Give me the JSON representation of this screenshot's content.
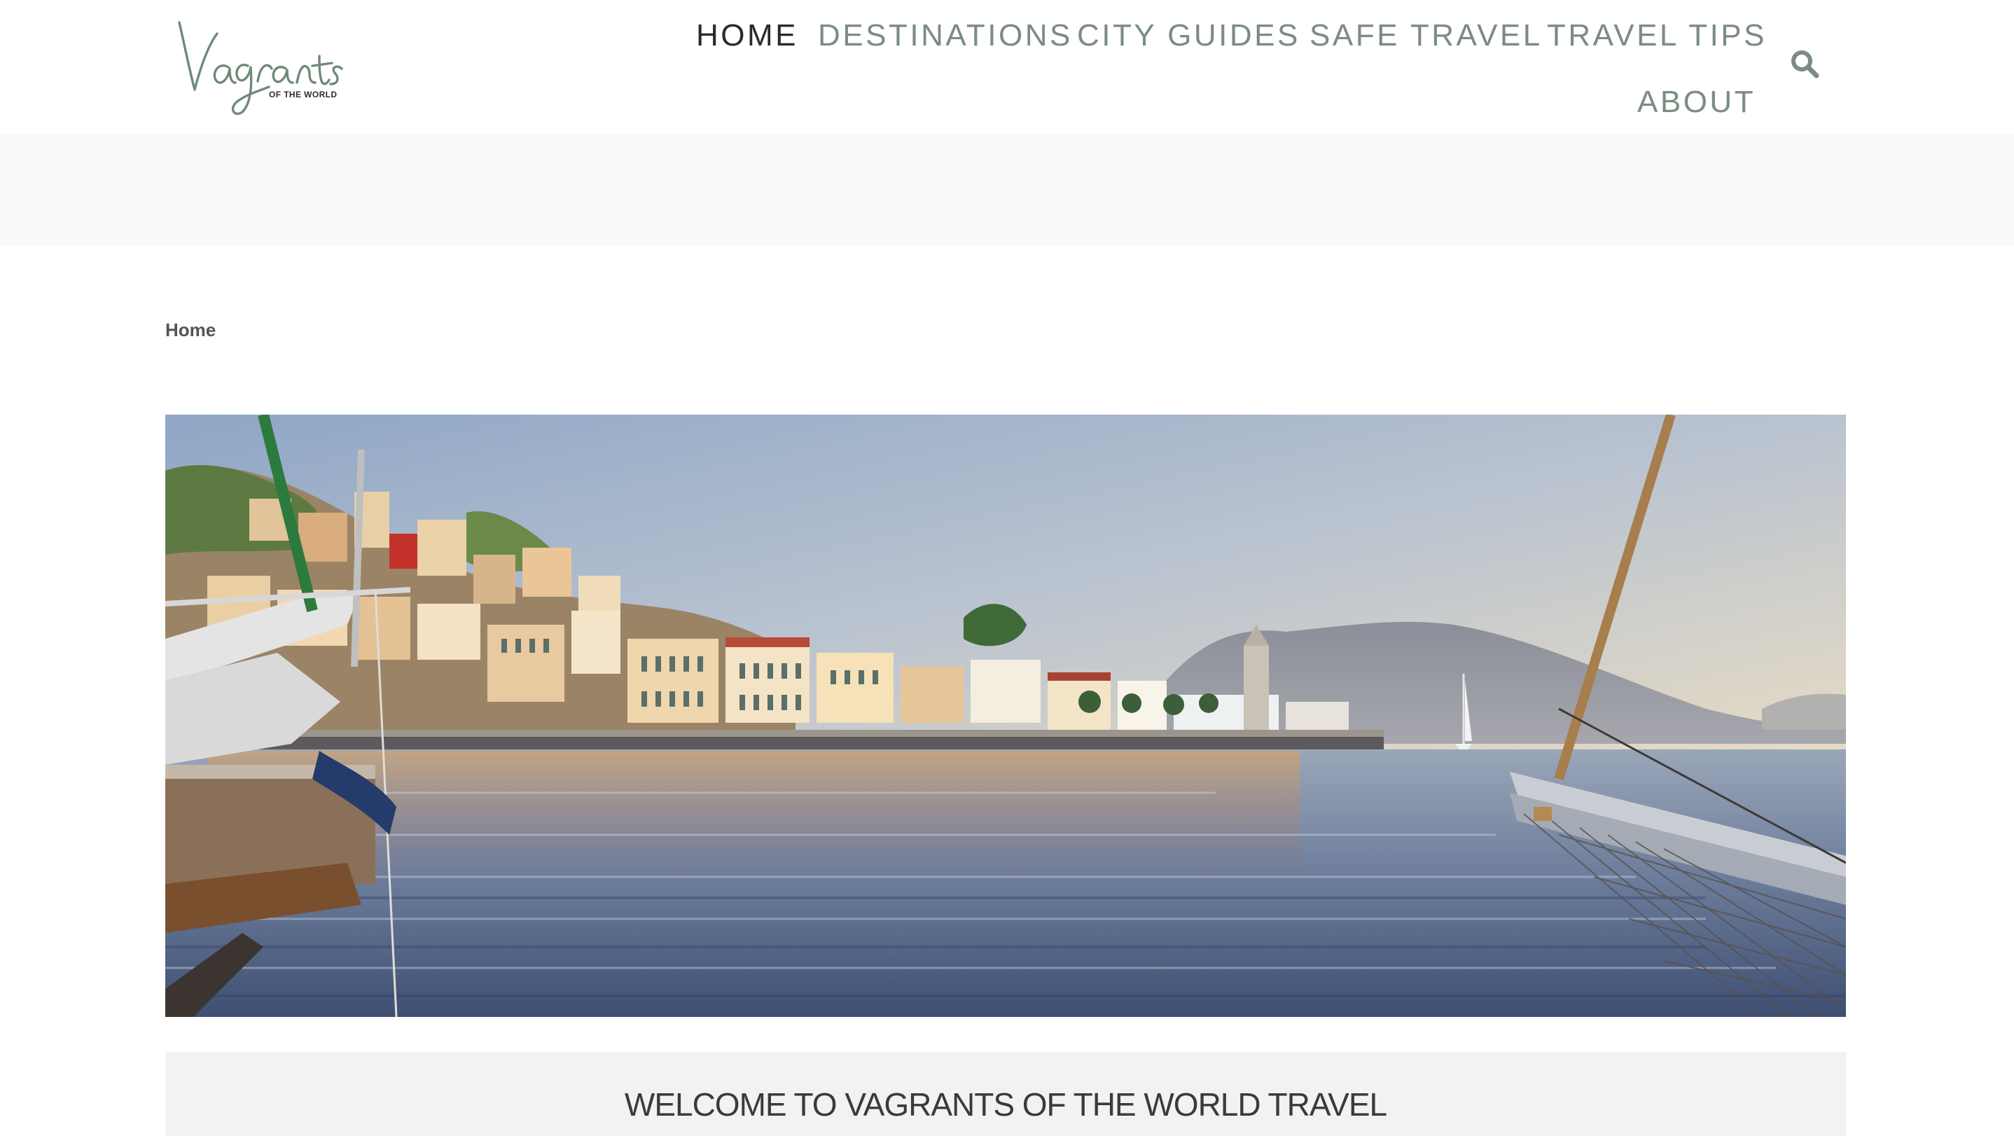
{
  "header": {
    "logo": {
      "script_text": "Vagrants",
      "tagline": "OF THE WORLD"
    },
    "nav": [
      {
        "label": "HOME",
        "active": true
      },
      {
        "label": "DESTINATIONS",
        "active": false
      },
      {
        "label": "CITY GUIDES",
        "active": false
      },
      {
        "label": "SAFE TRAVEL",
        "active": false
      },
      {
        "label": "TRAVEL TIPS",
        "active": false
      },
      {
        "label": "ABOUT",
        "active": false
      }
    ],
    "search_icon": "search-icon"
  },
  "breadcrumb": {
    "current": "Home"
  },
  "welcome": {
    "title": "WELCOME TO VAGRANTS OF THE WORLD TRAVEL"
  },
  "colors": {
    "nav_text": "#7b8c80",
    "nav_active": "#2a2a2a",
    "band": "#f9f9f9",
    "welcome_bg": "#f2f2f2",
    "logo_green": "#6f8a78"
  }
}
